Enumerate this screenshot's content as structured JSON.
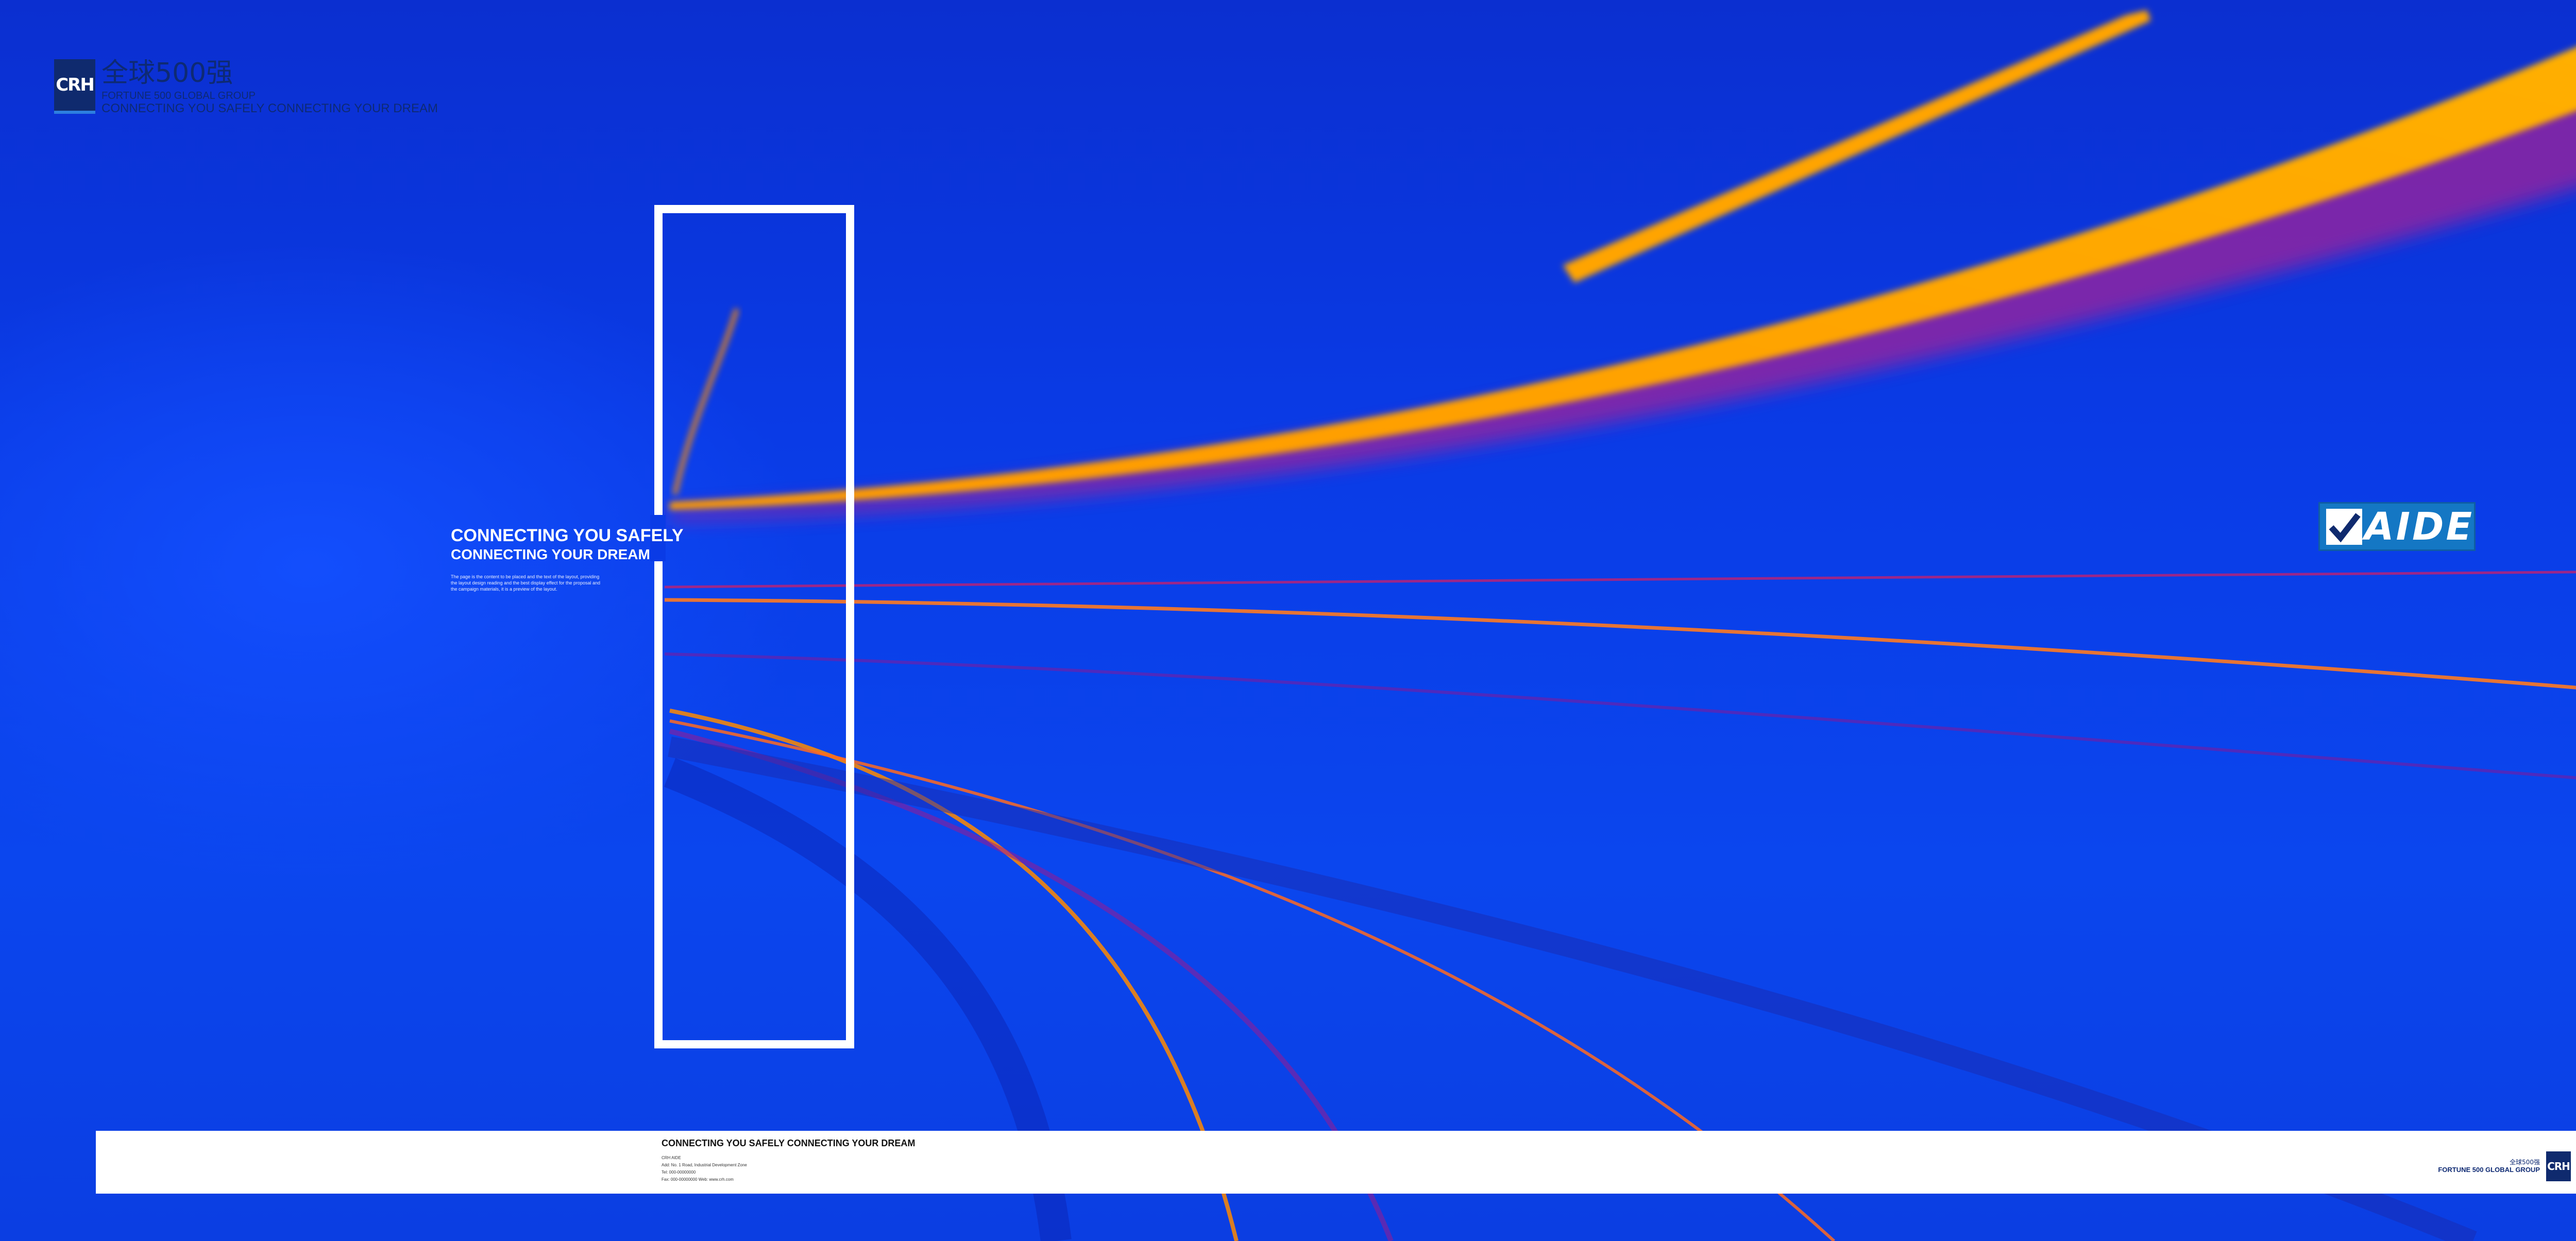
{
  "brand": {
    "logo_mark": "CRH",
    "title_cn": "全球500强",
    "subtitle_en": "FORTUNE 500 GLOBAL GROUP",
    "tagline": "CONNECTING YOU SAFELY  CONNECTING YOUR DREAM"
  },
  "headline": {
    "line1": "CONNECTING YOU SAFELY",
    "line2": "CONNECTING YOUR DREAM",
    "body": "The page is the content to be placed and the text of the layout, providing the layout design reading and the best display effect for the proposal and the campaign materials, it is a preview of the layout."
  },
  "partner_logo": {
    "text": "AIDE"
  },
  "footer": {
    "title": "CONNECTING YOU SAFELY  CONNECTING YOUR DREAM",
    "lines": [
      "CRH AIDE",
      "Add: No. 1 Road, Industrial Development Zone",
      "Tel: 000-00000000",
      "Fax: 000-00000000   Web: www.crh.com"
    ],
    "right_cn": "全球500强",
    "right_en": "FORTUNE 500 GLOBAL GROUP",
    "logo_mark": "CRH"
  },
  "colors": {
    "background": "#0a3be6",
    "streak_orange": "#ffa400",
    "streak_magenta": "#b0207a",
    "navy": "#0f2a6e"
  }
}
